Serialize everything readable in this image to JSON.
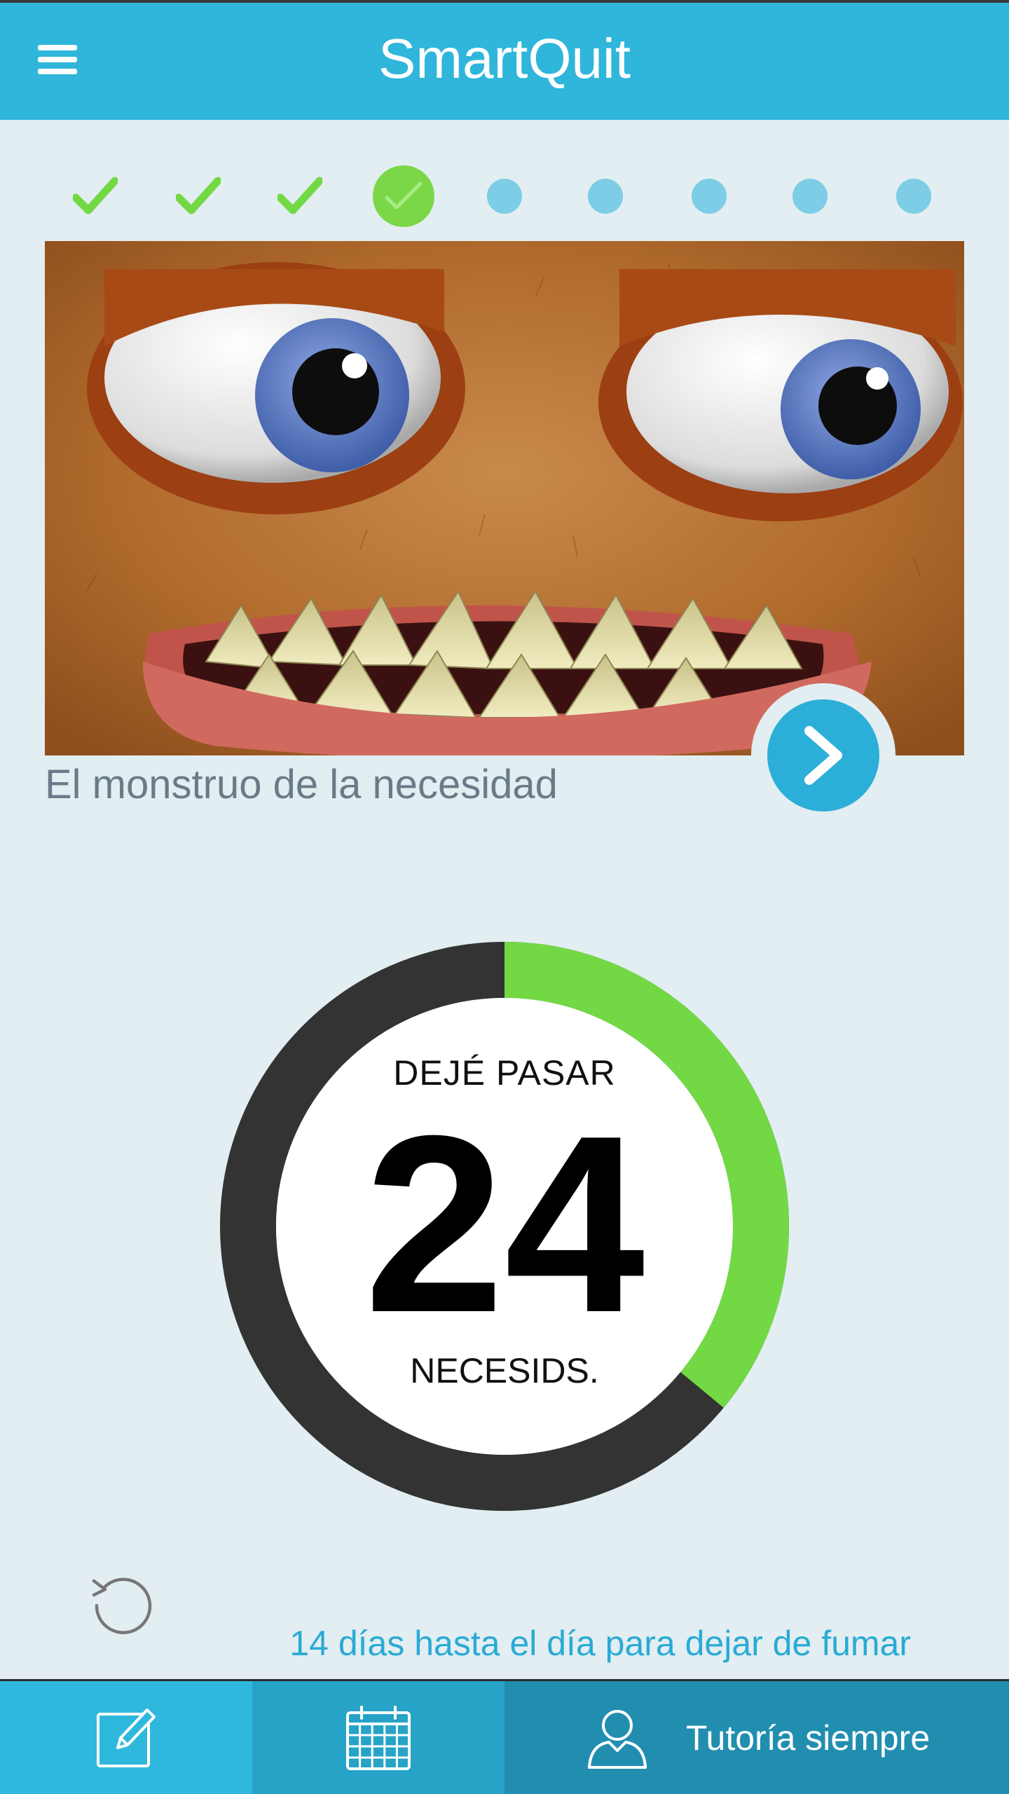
{
  "header": {
    "title": "SmartQuit",
    "menu_icon": "hamburger-menu-icon"
  },
  "progress_steps": {
    "completed": 3,
    "current": 4,
    "total": 9
  },
  "hero": {
    "caption": "El monstruo de la necesidad",
    "next_icon": "chevron-right-icon"
  },
  "counter": {
    "top_label": "DEJÉ PASAR",
    "value": "24",
    "bottom_label": "NECESIDS.",
    "progress_fraction": 0.36,
    "progress_color": "#72d944",
    "track_color": "#333333"
  },
  "footer_note": {
    "days_text": "14 días hasta el día para dejar de fumar"
  },
  "bottom_nav": {
    "notes_icon": "edit-note-icon",
    "calendar_icon": "calendar-icon",
    "tutor_icon": "user-icon",
    "tutor_label": "Tutoría siempre"
  },
  "colors": {
    "accent": "#2fb6da",
    "success": "#7bd748",
    "background": "#e2eef1"
  }
}
